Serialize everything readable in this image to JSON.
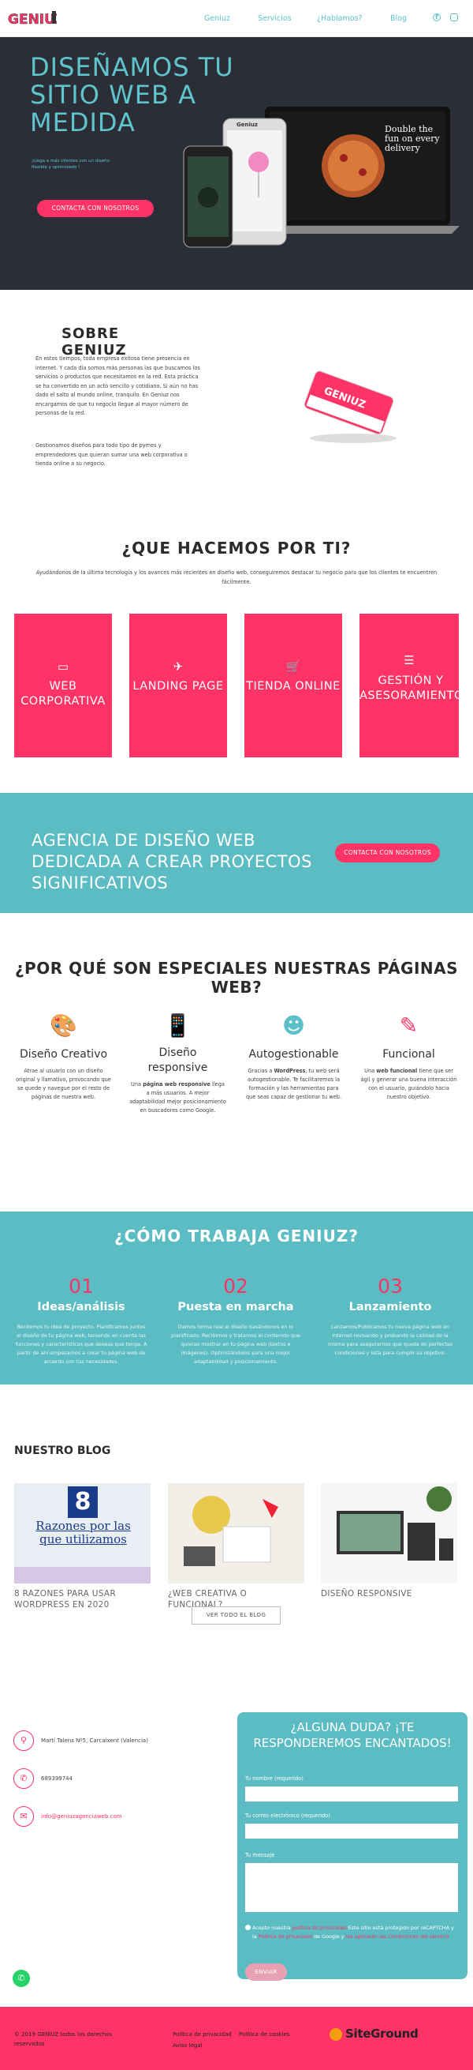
{
  "header": {
    "logo_text": "GENIUZ",
    "nav": [
      "Geniuz",
      "Servicios",
      "¿Hablamos?",
      "Blog"
    ],
    "social": [
      "facebook-icon",
      "instagram-icon"
    ]
  },
  "hero": {
    "title": "DISEÑAMOS TU SITIO WEB A MEDIDA",
    "subtitle": "¡Llega a más clientes con un diseño flexible y optimizado !",
    "button": "CONTACTA CON NOSOTROS",
    "laptop_text": "Double the fun on every delivery",
    "phone_brand": "Geniuz"
  },
  "sobre": {
    "title": "SOBRE GENIUZ",
    "p1": "En estos tiempos, toda empresa exitosa tiene presencia en internet. Y cada día somos más personas las que buscamos los servicios o productos que necesitamos en la red. Esta práctica se ha convertido en un acto sencillo y cotidiano. Si aún no has dado el salto al mundo online, tranquilo. En Geniuz nos encargamos de que tu negocio llegue al mayor número de personas de la red.",
    "p2": "Gestionamos diseños para todo tipo de pymes y emprendedores que quieran sumar una web corporativa o tienda online a su negocio."
  },
  "que": {
    "title": "¿QUE HACEMOS POR TI?",
    "text": "Ayudándonos de la última tecnología y los avances más recientes en diseño web, conseguiremos destacar tu negocio para que los clientes te encuentren fácilmente.",
    "cards": [
      {
        "icon": "laptop-icon",
        "label": "WEB CORPORATIVA"
      },
      {
        "icon": "plane-icon",
        "label": "LANDING PAGE"
      },
      {
        "icon": "cart-icon",
        "label": "TIENDA ONLINE"
      },
      {
        "icon": "list-icon",
        "label": "GESTIÓN Y ASESORAMIENTO"
      }
    ]
  },
  "agencia": {
    "title": "AGENCIA DE DISEÑO WEB DEDICADA A CREAR PROYECTOS SIGNIFICATIVOS",
    "button": "CONTACTA CON NOSOTROS"
  },
  "porque": {
    "title": "¿POR QUÉ SON ESPECIALES NUESTRAS PÁGINAS WEB?",
    "features": [
      {
        "icon": "paint-palette-icon",
        "title": "Diseño Creativo",
        "text": "Atrae al usuario con un diseño original y llamativo, provocando que se quede y navegue por el resto de páginas de nuestra web."
      },
      {
        "icon": "smartphone-icon",
        "title": "Diseño responsive",
        "bold": "página web responsive",
        "pre": "Una ",
        "text": " llega a más usuarios. A mejor adaptabilidad mejor posicionamiento en buscadores como Google."
      },
      {
        "icon": "smiley-icon",
        "title": "Autogestionable",
        "pre": "Gracias a ",
        "bold": "WordPress",
        "text": ", tu web será autogestionable. Te facilitaremos la formación y las herramientas para que seas capaz de gestionar tu web."
      },
      {
        "icon": "edit-icon",
        "title": "Funcional",
        "pre": "Una ",
        "bold": "web funcional",
        "text": " tiene que ser ágil y generar una buena interacción con el usuario, guiándolo hacia nuestro objetivo."
      }
    ]
  },
  "como": {
    "title": "¿CÓMO TRABAJA GENIUZ?",
    "steps": [
      {
        "num": "01",
        "title": "Ideas/análisis",
        "text": "Recibimos tu idea de proyecto. Planificamos juntos el diseño de tu página web, teniendo en cuenta las funciones y características que deseas que tenga. A partir de ahí empezamos a crear tu página web de acuerdo con tus necesidades."
      },
      {
        "num": "02",
        "title": "Puesta en marcha",
        "text": "Damos forma real al diseño basándonos en lo planificado. Recibimos y tratamos el contenido que quieras mostrar en tu página web (textos e imágenes). Optimizándolos para una mejor adaptabilidad y posicionamiento."
      },
      {
        "num": "03",
        "title": "Lanzamiento",
        "text": "Lanzamos/Publicamos tu nueva página web en internet revisando y probando la calidad de la misma para asegurarnos que queda en perfectas condiciones y lista para cumplir su objetivo."
      }
    ]
  },
  "blog": {
    "title": "NUESTRO BLOG",
    "posts": [
      "8 RAZONES PARA USAR WORDPRESS EN 2020",
      "¿WEB CREATIVA O FUNCIONAL?",
      "DISEÑO RESPONSIVE"
    ],
    "post1_img": "8",
    "post1_img_text": "Razones por las que utilizamos",
    "button": "VER TODO EL BLOG"
  },
  "contact": {
    "address": "Martí Talens Nº5, Carcaixent (Valencia)",
    "phone": "689399744",
    "email": "info@geniuzagenciaweb.com"
  },
  "form": {
    "title": "¿ALGUNA DUDA? ¡TE RESPONDEREMOS ENCANTADOS!",
    "name_label": "Tu nombre (requerido)",
    "email_label": "Tu correo electrónico (requerido)",
    "message_label": "Tu mensaje",
    "accept_a": "Acepto nuestra ",
    "privacy1": "política de privacidad",
    "accept_b": " Este sitio está protegido por reCAPTCHA y la ",
    "privacy2": "Política de privacidad",
    "accept_c": " de Google y ",
    "terms": "los aplicarán las Condiciones del servicio",
    "send": "ENVIAR"
  },
  "footer": {
    "copyright": "© 2019 GENIUZ todos los derechos",
    "reserved": "reservados",
    "privacy": "Política de privacidad",
    "cookies": "Política de cookies",
    "legal": "Aviso legal",
    "hosting": "SiteGround"
  }
}
